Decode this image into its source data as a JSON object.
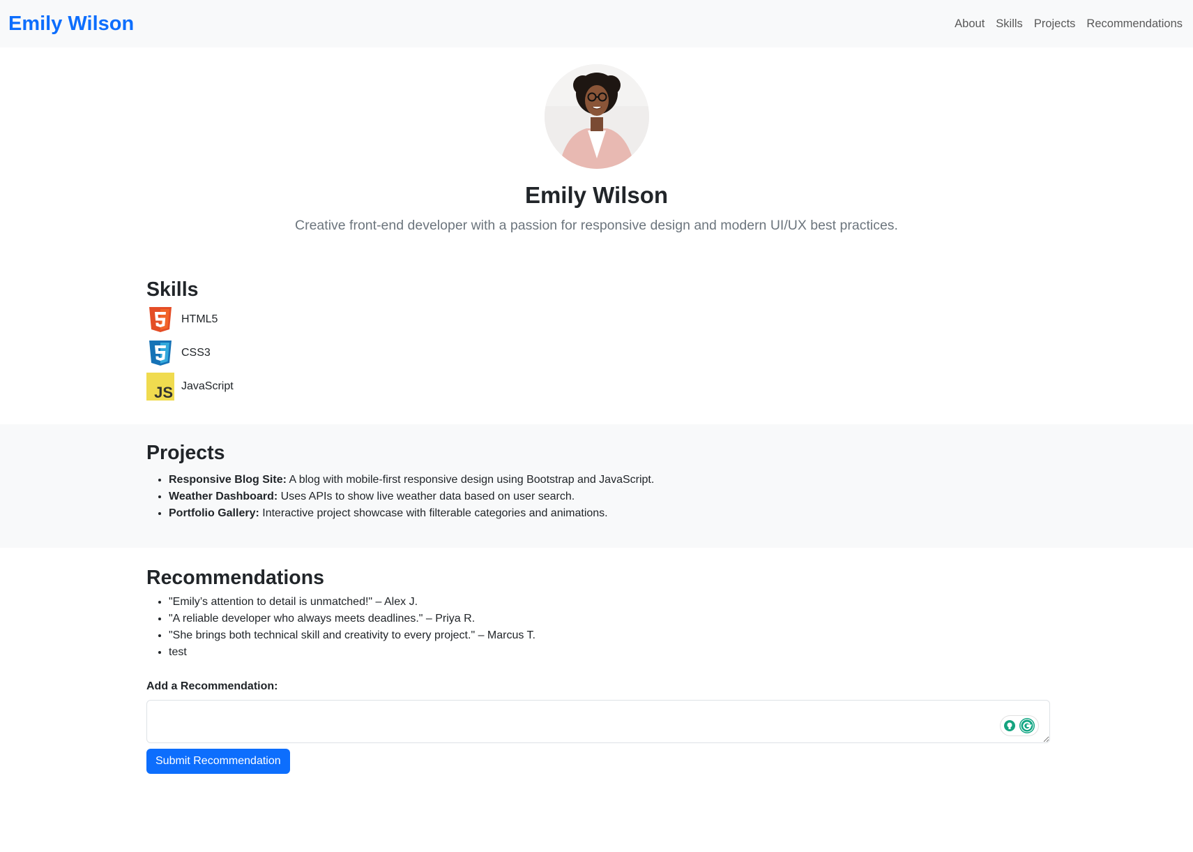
{
  "navbar": {
    "brand": "Emily Wilson",
    "links": [
      "About",
      "Skills",
      "Projects",
      "Recommendations"
    ]
  },
  "hero": {
    "name": "Emily Wilson",
    "tagline": "Creative front-end developer with a passion for responsive design and modern UI/UX best practices."
  },
  "skills": {
    "heading": "Skills",
    "items": [
      {
        "label": "HTML5",
        "icon": "html5-icon",
        "color": "#e44d26"
      },
      {
        "label": "CSS3",
        "icon": "css3-icon",
        "color": "#1572b6"
      },
      {
        "label": "JavaScript",
        "icon": "javascript-icon",
        "color": "#f0db4f"
      }
    ]
  },
  "projects": {
    "heading": "Projects",
    "items": [
      {
        "title": "Responsive Blog Site:",
        "desc": " A blog with mobile-first responsive design using Bootstrap and JavaScript."
      },
      {
        "title": "Weather Dashboard:",
        "desc": " Uses APIs to show live weather data based on user search."
      },
      {
        "title": "Portfolio Gallery:",
        "desc": " Interactive project showcase with filterable categories and animations."
      }
    ]
  },
  "recommendations": {
    "heading": "Recommendations",
    "items": [
      "\"Emily’s attention to detail is unmatched!\" – Alex J.",
      "\"A reliable developer who always meets deadlines.\" – Priya R.",
      "\"She brings both technical skill and creativity to every project.\" – Marcus T.",
      "test"
    ],
    "form_label": "Add a Recommendation:",
    "textarea_value": "",
    "submit_label": "Submit Recommendation"
  },
  "colors": {
    "accent": "#0d6efd",
    "band": "#f8f9fa"
  }
}
